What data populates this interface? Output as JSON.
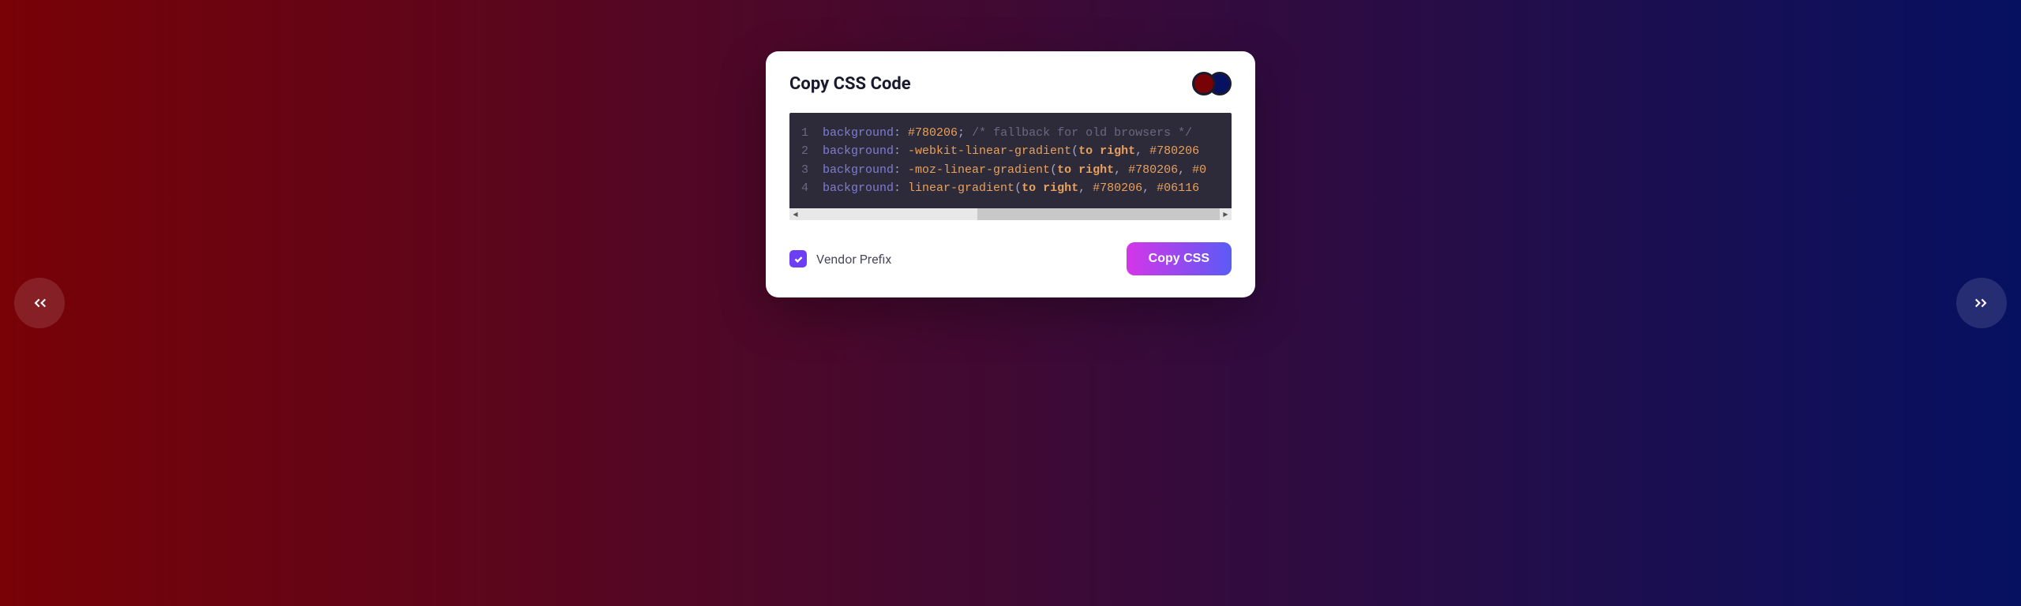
{
  "card": {
    "title": "Copy CSS Code",
    "colors": {
      "c1": "#780206",
      "c2": "#061161"
    }
  },
  "code": {
    "lines": [
      {
        "num": "1",
        "prop": "background",
        "val": "#780206",
        "comment": "/* fallback for old browsers */"
      },
      {
        "num": "2",
        "prop": "background",
        "func": "-webkit-linear-gradient",
        "args": "to right, #780206"
      },
      {
        "num": "3",
        "prop": "background",
        "func": "-moz-linear-gradient",
        "args": "to right, #780206, #0"
      },
      {
        "num": "4",
        "prop": "background",
        "func": "linear-gradient",
        "args": "to right, #780206, #06116"
      }
    ]
  },
  "footer": {
    "vendor_prefix_label": "Vendor Prefix",
    "vendor_prefix_checked": true,
    "copy_button": "Copy CSS"
  }
}
